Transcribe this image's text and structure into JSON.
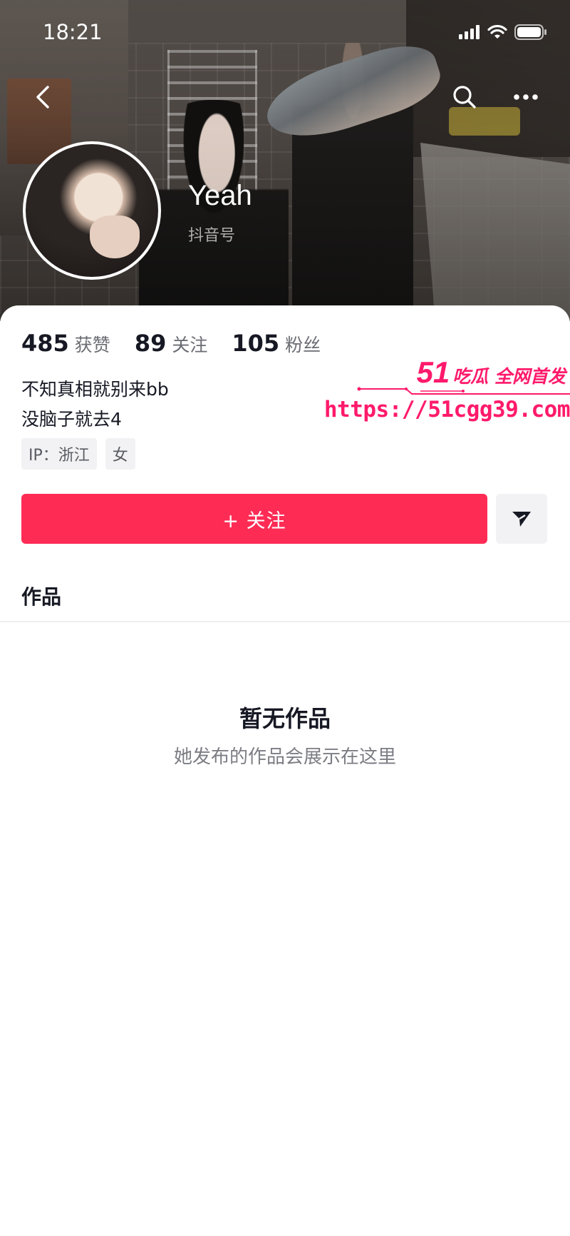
{
  "status_bar": {
    "time": "18:21"
  },
  "profile": {
    "nickname": "Yeah",
    "douyin_id_label": "抖音号",
    "stats": [
      {
        "value": "485",
        "label": "获赞"
      },
      {
        "value": "89",
        "label": "关注"
      },
      {
        "value": "105",
        "label": "粉丝"
      }
    ],
    "bio_lines": [
      "不知真相就别来bb",
      "没脑子就去4"
    ],
    "tags": [
      "IP：浙江",
      "女"
    ]
  },
  "actions": {
    "follow_label": "+ 关注"
  },
  "tabs": {
    "works_label": "作品"
  },
  "empty_state": {
    "title": "暂无作品",
    "subtitle": "她发布的作品会展示在这里"
  },
  "watermark": {
    "number": "51",
    "brand": "吃瓜 全网首发",
    "url": "https://51cgg39.com"
  },
  "colors": {
    "accent": "#fe2c55",
    "watermark": "#ff1a6b",
    "text_primary": "#161823",
    "text_secondary": "#6b6c73"
  },
  "icons": [
    "back-icon",
    "search-icon",
    "more-icon",
    "share-icon",
    "signal-icon",
    "wifi-icon",
    "battery-icon"
  ]
}
